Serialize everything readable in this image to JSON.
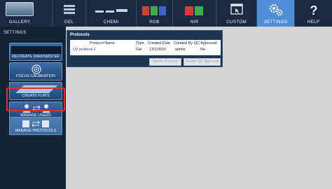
{
  "nav": {
    "tabs": [
      {
        "label": "GALLERY",
        "icon": "gallery-icon"
      },
      {
        "label": "GEL",
        "icon": "gel-icon"
      },
      {
        "label": "CHEMI",
        "icon": "chemi-icon"
      },
      {
        "label": "RGB",
        "icon": "rgb-icon"
      },
      {
        "label": "NIR",
        "icon": "nir-icon"
      },
      {
        "label": "CUSTOM",
        "icon": "custom-icon"
      },
      {
        "label": "SETTINGS",
        "icon": "gears-icon",
        "active": true
      },
      {
        "label": "HELP",
        "icon": "help-icon"
      }
    ]
  },
  "sidebar": {
    "title": "SETTINGS",
    "items": [
      {
        "label": "RECREATE DARKMASTER",
        "icon": "darkmaster-icon"
      },
      {
        "label": "FOCUS CALIBRATION",
        "icon": "focus-calibration-icon"
      },
      {
        "label": "CREATE FLATS",
        "icon": "flats-icon"
      },
      {
        "label": "MANAGE USERS",
        "icon": "users-icon"
      },
      {
        "label": "MANAGE PROTOCOLS",
        "icon": "protocols-icon",
        "active": true
      }
    ]
  },
  "protocols": {
    "title": "Protocols",
    "columns": [
      "Protocol Name",
      "Type",
      "Created Date",
      "Created By",
      "QC Approved"
    ],
    "rows": [
      {
        "name": "UV protocol 1",
        "type": "Gel",
        "created_date": "13/1/2016",
        "created_by": "admin",
        "qc_approved": "No"
      }
    ],
    "buttons": {
      "delete": "Delete Protocol",
      "enable_qc": "Enable QC Approval"
    }
  },
  "colors": {
    "nav_bg": "#1b2a3f",
    "active_tab": "#4f8ed4",
    "sidebar_bg": "#152233",
    "highlight": "#d9312f",
    "panel_bg": "#1f3554",
    "content_bg": "#d2d4d6"
  }
}
